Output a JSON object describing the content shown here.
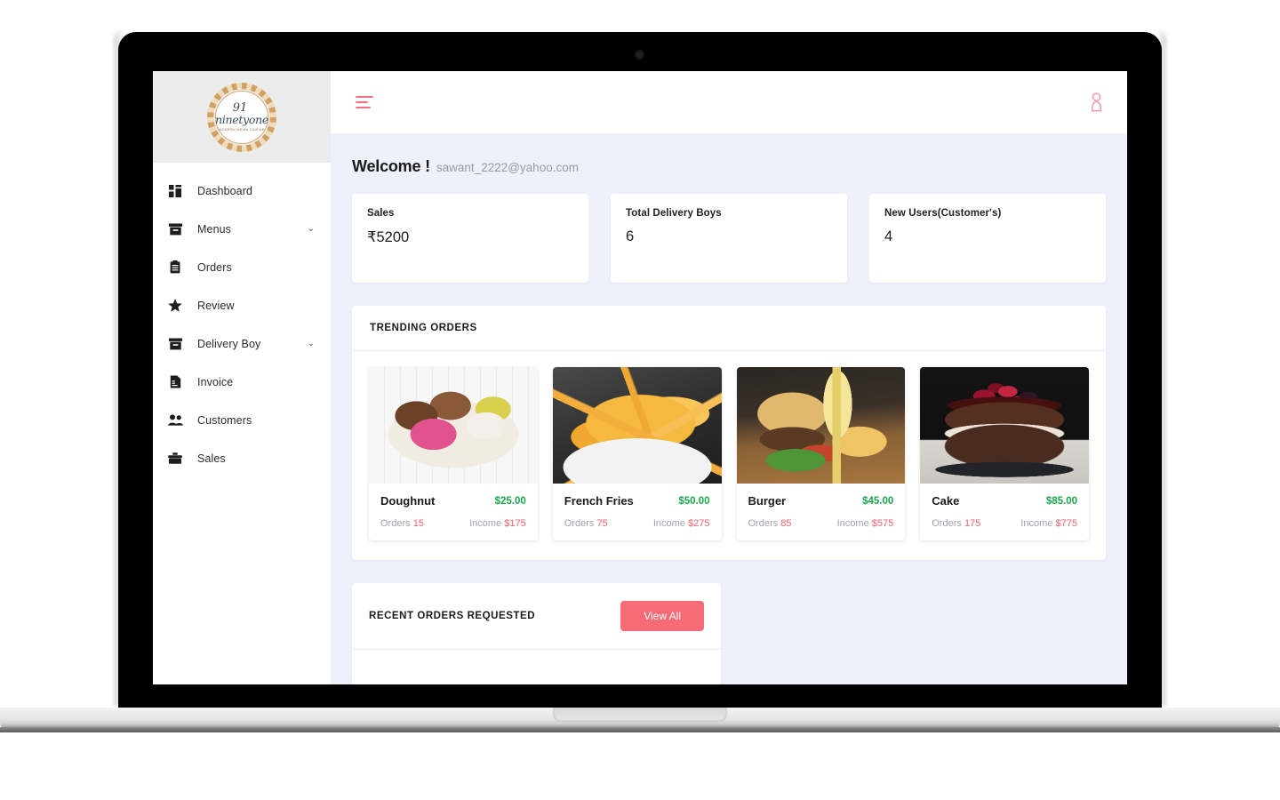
{
  "brand": {
    "number": "91",
    "word": "ninetyone",
    "tagline": "Modern Indian Cuisine"
  },
  "sidebar": {
    "items": [
      {
        "label": "Dashboard",
        "icon": "dashboard-icon",
        "chevron": ""
      },
      {
        "label": "Menus",
        "icon": "archive-icon",
        "chevron": "⌄"
      },
      {
        "label": "Orders",
        "icon": "clipboard-icon",
        "chevron": ""
      },
      {
        "label": "Review",
        "icon": "star-icon",
        "chevron": ""
      },
      {
        "label": "Delivery Boy",
        "icon": "archive-icon",
        "chevron": "⌄"
      },
      {
        "label": "Invoice",
        "icon": "document-icon",
        "chevron": ""
      },
      {
        "label": "Customers",
        "icon": "people-icon",
        "chevron": ""
      },
      {
        "label": "Sales",
        "icon": "briefcase-icon",
        "chevron": ""
      }
    ]
  },
  "topbar": {
    "menu_icon": "hamburger-icon",
    "user_icon": "user-account-icon"
  },
  "welcome": {
    "title": "Welcome !",
    "email": "sawant_2222@yahoo.com"
  },
  "stats": [
    {
      "label": "Sales",
      "value": "₹5200"
    },
    {
      "label": "Total Delivery Boys",
      "value": "6"
    },
    {
      "label": "New Users(Customer's)",
      "value": "4"
    }
  ],
  "trending": {
    "title": "TRENDING ORDERS",
    "orders_label": "Orders",
    "income_label": "Income",
    "products": [
      {
        "name": "Doughnut",
        "price": "$25.00",
        "orders": "15",
        "income": "$175",
        "image": "doughnuts-photo"
      },
      {
        "name": "French Fries",
        "price": "$50.00",
        "orders": "75",
        "income": "$275",
        "image": "french-fries-photo"
      },
      {
        "name": "Burger",
        "price": "$45.00",
        "orders": "85",
        "income": "$575",
        "image": "burger-photo"
      },
      {
        "name": "Cake",
        "price": "$85.00",
        "orders": "175",
        "income": "$775",
        "image": "cake-photo"
      }
    ]
  },
  "recent": {
    "title": "RECENT ORDERS REQUESTED",
    "view_all": "View All"
  },
  "colors": {
    "accent": "#f76b77",
    "price_green": "#1aa64b",
    "content_bg": "#eef0fa"
  }
}
